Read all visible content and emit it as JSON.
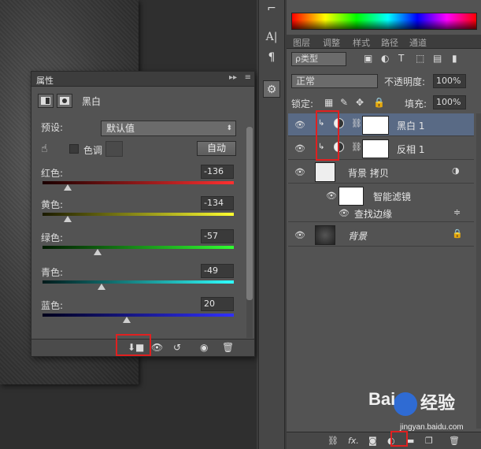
{
  "properties_panel": {
    "tab_label": "属性",
    "collapse_glyph": "▸▸",
    "menu_glyph": "≡",
    "adjustment_name": "黑白",
    "preset_label": "预设:",
    "preset_value": "默认值",
    "tint_label": "色调",
    "auto_label": "自动",
    "sliders": [
      {
        "label": "红色:",
        "value": "-136",
        "level": 0.13,
        "gradient": [
          "#1a0000",
          "#ff3030"
        ]
      },
      {
        "label": "黄色:",
        "value": "-134",
        "level": 0.13,
        "gradient": [
          "#1a1a00",
          "#ffff30"
        ]
      },
      {
        "label": "绿色:",
        "value": "-57",
        "level": 0.29,
        "gradient": [
          "#001a00",
          "#30ff30"
        ]
      },
      {
        "label": "青色:",
        "value": "-49",
        "level": 0.31,
        "gradient": [
          "#001a1a",
          "#30ffff"
        ]
      },
      {
        "label": "蓝色:",
        "value": "20",
        "level": 0.44,
        "gradient": [
          "#00001a",
          "#3030ff"
        ]
      }
    ]
  },
  "layers_panel": {
    "tabs": [
      "图层",
      "调整",
      "样式",
      "路径",
      "通道"
    ],
    "active_tab": 0,
    "kind_label": "ρ类型",
    "blend_mode": "正常",
    "opacity_label": "不透明度:",
    "opacity_value": "100%",
    "lock_label": "锁定:",
    "fill_label": "填充:",
    "fill_value": "100%",
    "layers": [
      {
        "name": "黑白 1",
        "type": "adjustment",
        "selected": true
      },
      {
        "name": "反相 1",
        "type": "adjustment",
        "selected": false
      },
      {
        "name": "背景 拷贝",
        "type": "image",
        "selected": false
      },
      {
        "name": "智能滤镜",
        "type": "smart-filter",
        "selected": false
      },
      {
        "name": "查找边缘",
        "type": "filter",
        "selected": false
      },
      {
        "name": "背景",
        "type": "background",
        "selected": false
      }
    ]
  },
  "colors": {
    "selection": "#596a85",
    "highlight_box": "#e02020"
  },
  "watermark": {
    "brand": "Bai",
    "brand_suffix": "经验",
    "sub": "jingyan.baidu.com"
  }
}
